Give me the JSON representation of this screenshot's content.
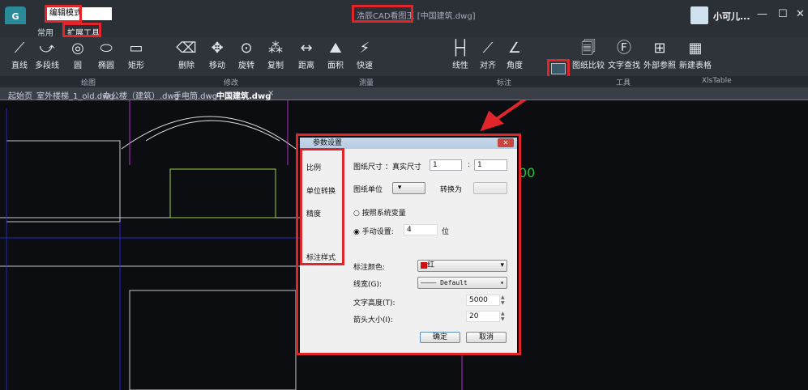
{
  "titlebar": {
    "mode": "编辑模式",
    "app_title": "浩辰CAD看图王",
    "doc_title": "[中国建筑.dwg]",
    "user": "小可儿...",
    "minimize": "—",
    "maximize": "☐",
    "close": "✕"
  },
  "menu_tabs": [
    "常用",
    "扩展工具"
  ],
  "ribbon": {
    "draw": [
      "直线",
      "多段线",
      "圆",
      "椭圆",
      "矩形"
    ],
    "modify": [
      "删除",
      "移动",
      "旋转",
      "复制"
    ],
    "measure": [
      "距离",
      "面积",
      "快速"
    ],
    "annotate": [
      "线性",
      "对齐",
      "角度"
    ],
    "tools": [
      "图纸比较",
      "文字查找",
      "外部参照"
    ],
    "xls": [
      "新建表格"
    ],
    "groups": [
      "绘图",
      "修改",
      "测量",
      "标注",
      "工具",
      "XlsTable"
    ]
  },
  "doc_tabs": [
    "起始页",
    "室外楼梯_1_old.dwg",
    "办公楼（建筑）.dwg",
    "手电筒.dwg",
    "中国建筑.dwg"
  ],
  "canvas_text": "00",
  "dialog": {
    "title": "参数设置",
    "side": [
      "比例",
      "单位转换",
      "精度",
      "标注样式"
    ],
    "paper_size_label": "图纸尺寸 ：",
    "real_size_label": "真实尺寸",
    "paper_value": "1",
    "colon": ":",
    "real_value": "1",
    "paper_unit_label": "图纸单位",
    "convert_label": "转换为",
    "radio_system": "按照系统变量",
    "radio_manual": "手动设置:",
    "precision": "4",
    "digits": "位",
    "color_label": "标注颜色:",
    "color_value": "红",
    "color_hex": "#d01010",
    "linewidth_label": "线宽(G):",
    "linewidth_value": "———— Default",
    "text_height_label": "文字高度(T):",
    "text_height": "5000",
    "arrow_label": "箭头大小(I):",
    "arrow_size": "20",
    "ok": "确定",
    "cancel": "取消"
  }
}
